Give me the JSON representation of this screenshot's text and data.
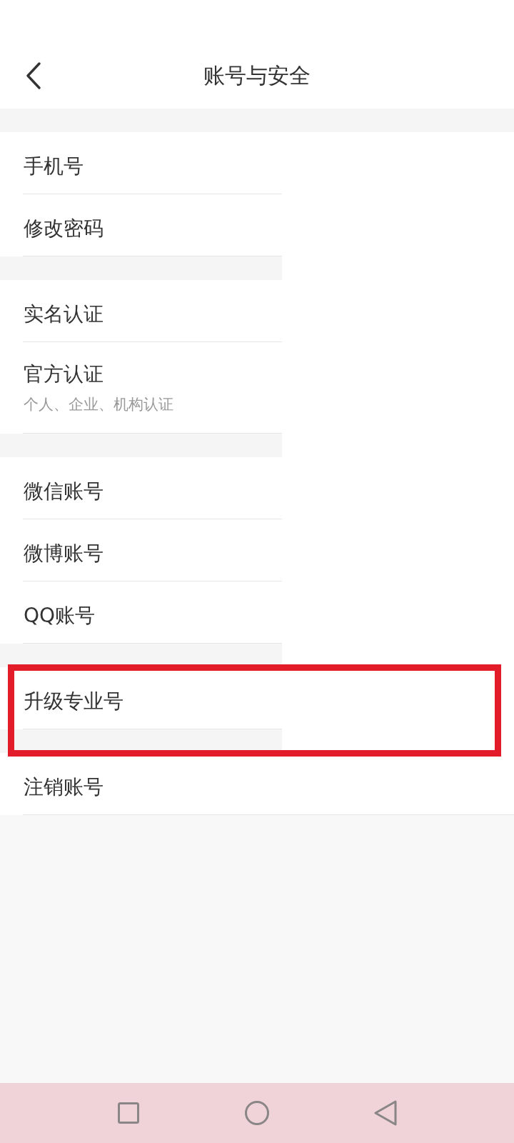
{
  "header": {
    "title": "账号与安全"
  },
  "sections": [
    {
      "items": [
        {
          "label": "手机号",
          "highlighted": false
        },
        {
          "label": "修改密码",
          "highlighted": false
        }
      ]
    },
    {
      "items": [
        {
          "label": "实名认证",
          "highlighted": false
        },
        {
          "label": "官方认证",
          "subtitle": "个人、企业、机构认证",
          "highlighted": false
        }
      ]
    },
    {
      "items": [
        {
          "label": "微信账号",
          "highlighted": false
        },
        {
          "label": "微博账号",
          "highlighted": false
        },
        {
          "label": "QQ账号",
          "highlighted": false
        }
      ]
    },
    {
      "items": [
        {
          "label": "升级专业号",
          "highlighted": true
        }
      ]
    },
    {
      "items": [
        {
          "label": "注销账号",
          "highlighted": false
        }
      ]
    }
  ]
}
